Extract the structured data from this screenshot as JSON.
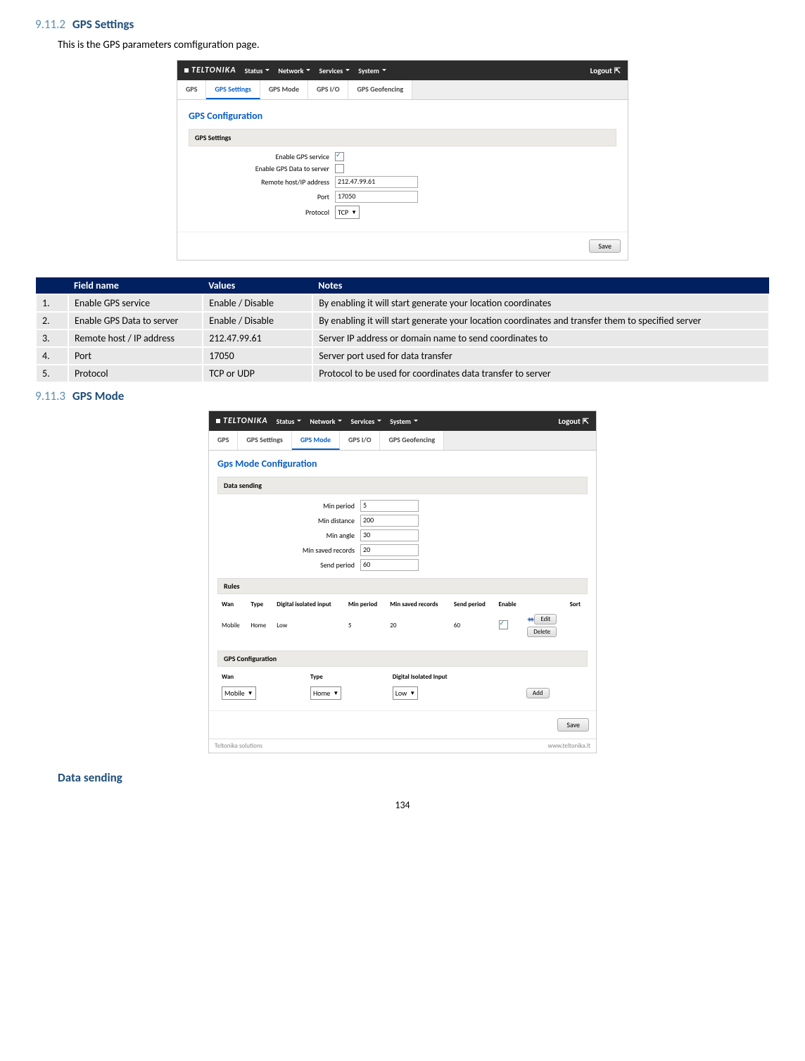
{
  "section1": {
    "num": "9.11.2",
    "title": "GPS Settings",
    "intro": "This is the GPS parameters comfiguration page."
  },
  "nav": {
    "brand": "TELTONIKA",
    "status": "Status",
    "network": "Network",
    "services": "Services",
    "system": "System",
    "logout": "Logout"
  },
  "tabs1": {
    "gps": "GPS",
    "settings": "GPS Settings",
    "mode": "GPS Mode",
    "io": "GPS I/O",
    "geo": "GPS Geofencing"
  },
  "panel1": {
    "title": "GPS Configuration",
    "subtitle": "GPS Settings",
    "enable_service_label": "Enable GPS service",
    "enable_data_label": "Enable GPS Data to server",
    "remote_label": "Remote host/IP address",
    "remote_value": "212.47.99.61",
    "port_label": "Port",
    "port_value": "17050",
    "protocol_label": "Protocol",
    "protocol_value": "TCP",
    "save": "Save"
  },
  "table": {
    "h1": "Field name",
    "h2": "Values",
    "h3": "Notes",
    "rows": [
      {
        "n": "1.",
        "f": "Enable GPS service",
        "v": "Enable / Disable",
        "d": "By enabling it will start generate your location coordinates"
      },
      {
        "n": "2.",
        "f": "Enable GPS Data to server",
        "v": "Enable / Disable",
        "d": "By enabling it will start generate your location coordinates and transfer them to specified server"
      },
      {
        "n": "3.",
        "f": "Remote host / IP address",
        "v": "212.47.99.61",
        "d": "Server IP address or domain name to send coordinates to"
      },
      {
        "n": "4.",
        "f": "Port",
        "v": "17050",
        "d": "Server port used for data transfer"
      },
      {
        "n": "5.",
        "f": "Protocol",
        "v": "TCP or UDP",
        "d": "Protocol to be used for coordinates data transfer to server"
      }
    ]
  },
  "section2": {
    "num": "9.11.3",
    "title": "GPS Mode"
  },
  "panel2": {
    "title": "Gps Mode Configuration",
    "datasending": "Data sending",
    "min_period_label": "Min period",
    "min_period_value": "5",
    "min_distance_label": "Min distance",
    "min_distance_value": "200",
    "min_angle_label": "Min angle",
    "min_angle_value": "30",
    "min_saved_label": "Min saved records",
    "min_saved_value": "20",
    "send_period_label": "Send period",
    "send_period_value": "60",
    "rules": "Rules",
    "cols": {
      "wan": "Wan",
      "type": "Type",
      "dii": "Digital isolated input",
      "minp": "Min period",
      "minsr": "Min saved records",
      "sendp": "Send period",
      "enable": "Enable",
      "sort": "Sort"
    },
    "row": {
      "wan": "Mobile",
      "type": "Home",
      "dii": "Low",
      "minp": "5",
      "minsr": "20",
      "sendp": "60",
      "edit": "Edit",
      "delete": "Delete"
    },
    "gpsconf": "GPS Configuration",
    "conf": {
      "wan": "Wan",
      "type": "Type",
      "dii": "Digital Isolated Input",
      "wan_v": "Mobile",
      "type_v": "Home",
      "dii_v": "Low",
      "add": "Add"
    },
    "save": "Save",
    "footer_left": "Teltonika solutions",
    "footer_right": "www.teltonika.lt"
  },
  "section3": {
    "title": "Data sending"
  },
  "pagenum": "134"
}
